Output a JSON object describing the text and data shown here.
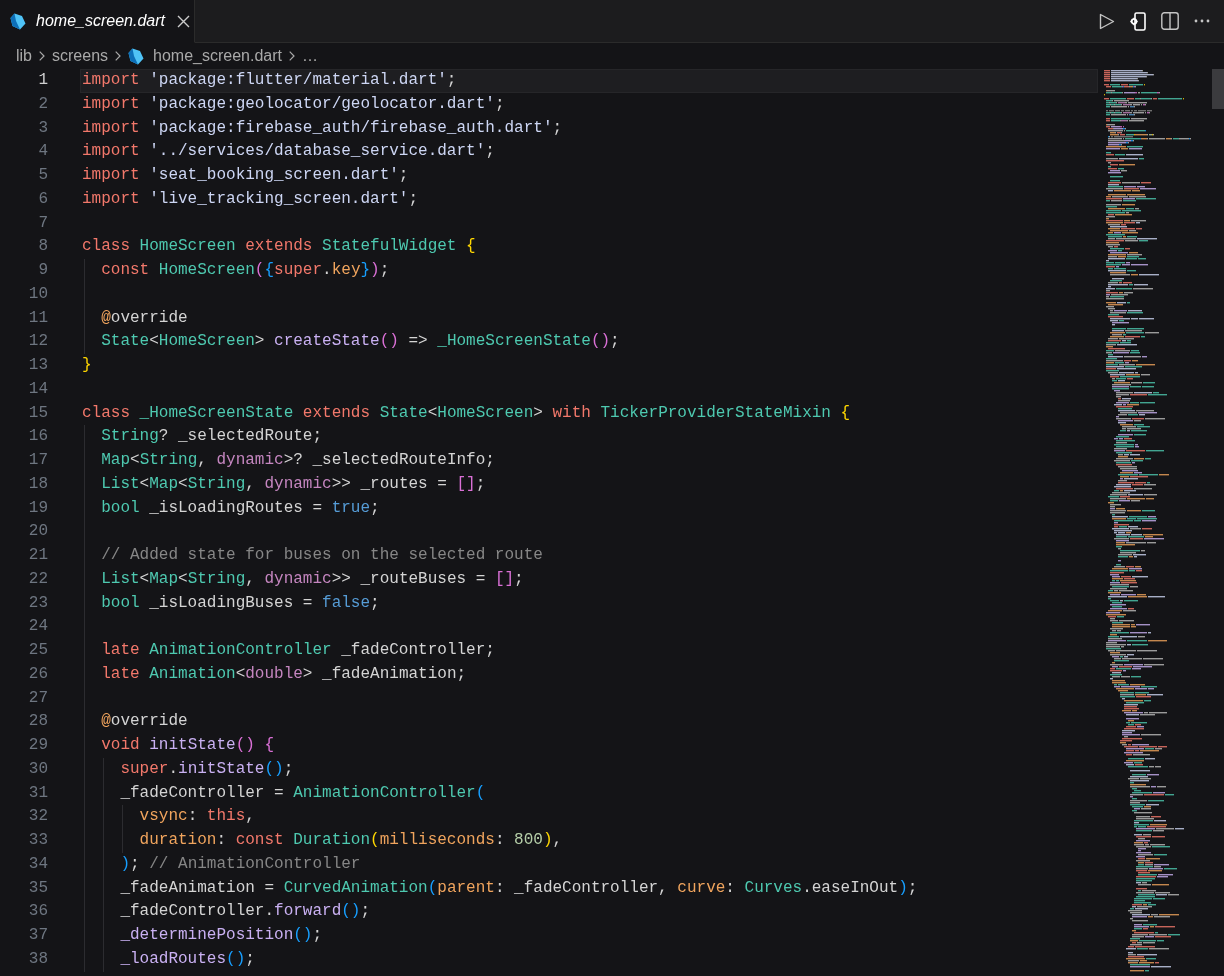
{
  "tabs": [
    {
      "label": "home_screen.dart",
      "selected": true,
      "preview": true
    }
  ],
  "breadcrumbs": [
    {
      "text": "lib",
      "kind": "folder"
    },
    {
      "text": "screens",
      "kind": "folder"
    },
    {
      "text": "home_screen.dart",
      "kind": "file"
    },
    {
      "text": "…",
      "kind": "more"
    }
  ],
  "editor": {
    "lines": [
      {
        "number": "1",
        "current": true,
        "tokens": [
          {
            "text": "import",
            "kind": "keyword"
          },
          {
            "text": " 'package:flutter/material.dart'",
            "kind": "string"
          },
          {
            "text": ";",
            "kind": "plain"
          }
        ]
      },
      {
        "number": "2",
        "current": false,
        "tokens": [
          {
            "text": "import",
            "kind": "keyword"
          },
          {
            "text": " 'package:geolocator/geolocator.dart'",
            "kind": "string"
          },
          {
            "text": ";",
            "kind": "plain"
          }
        ]
      },
      {
        "number": "3",
        "current": false,
        "tokens": [
          {
            "text": "import",
            "kind": "keyword"
          },
          {
            "text": " 'package:firebase_auth/firebase_auth.dart'",
            "kind": "string"
          },
          {
            "text": ";",
            "kind": "plain"
          }
        ]
      },
      {
        "number": "4",
        "current": false,
        "tokens": [
          {
            "text": "import",
            "kind": "keyword"
          },
          {
            "text": " '../services/database_service.dart'",
            "kind": "string"
          },
          {
            "text": ";",
            "kind": "plain"
          }
        ]
      },
      {
        "number": "5",
        "current": false,
        "tokens": [
          {
            "text": "import",
            "kind": "keyword"
          },
          {
            "text": " 'seat_booking_screen.dart'",
            "kind": "string"
          },
          {
            "text": ";",
            "kind": "plain"
          }
        ]
      },
      {
        "number": "6",
        "current": false,
        "tokens": [
          {
            "text": "import",
            "kind": "keyword"
          },
          {
            "text": " 'live_tracking_screen.dart'",
            "kind": "string"
          },
          {
            "text": ";",
            "kind": "plain"
          }
        ]
      },
      {
        "number": "7",
        "current": false
      },
      {
        "number": "8",
        "current": false,
        "tokens": [
          {
            "text": "class ",
            "kind": "keyword"
          },
          {
            "text": "HomeScreen",
            "kind": "type"
          },
          {
            "text": " extends ",
            "kind": "keyword"
          },
          {
            "text": "StatefulWidget",
            "kind": "type"
          },
          {
            "text": " {",
            "kind": "brace1"
          }
        ]
      },
      {
        "number": "9",
        "current": false,
        "tokens": [
          {
            "text": "  const ",
            "kind": "keyword"
          },
          {
            "text": "HomeScreen",
            "kind": "type"
          },
          {
            "text": "(",
            "kind": "brace2"
          },
          {
            "text": "{",
            "kind": "brace3"
          },
          {
            "text": "super",
            "kind": "keyword"
          },
          {
            "text": ".",
            "kind": "plain"
          },
          {
            "text": "key",
            "kind": "param"
          },
          {
            "text": "}",
            "kind": "brace3"
          },
          {
            "text": ")",
            "kind": "brace2"
          },
          {
            "text": ";",
            "kind": "plain"
          }
        ]
      },
      {
        "number": "10",
        "current": false
      },
      {
        "number": "11",
        "current": false,
        "tokens": [
          {
            "text": "  @",
            "kind": "annotation"
          },
          {
            "text": "override",
            "kind": "plain"
          }
        ]
      },
      {
        "number": "12",
        "current": false,
        "tokens": [
          {
            "text": "  State",
            "kind": "type"
          },
          {
            "text": "<",
            "kind": "plain"
          },
          {
            "text": "HomeScreen",
            "kind": "type"
          },
          {
            "text": "> ",
            "kind": "plain"
          },
          {
            "text": "createState",
            "kind": "func"
          },
          {
            "text": "()",
            "kind": "brace2"
          },
          {
            "text": " => ",
            "kind": "plain"
          },
          {
            "text": "_HomeScreenState",
            "kind": "type"
          },
          {
            "text": "()",
            "kind": "brace2"
          },
          {
            "text": ";",
            "kind": "plain"
          }
        ]
      },
      {
        "number": "13",
        "current": false,
        "tokens": [
          {
            "text": "}",
            "kind": "brace1"
          }
        ]
      },
      {
        "number": "14",
        "current": false
      },
      {
        "number": "15",
        "current": false,
        "tokens": [
          {
            "text": "class ",
            "kind": "keyword"
          },
          {
            "text": "_HomeScreenState",
            "kind": "type"
          },
          {
            "text": " extends ",
            "kind": "keyword"
          },
          {
            "text": "State",
            "kind": "type"
          },
          {
            "text": "<",
            "kind": "plain"
          },
          {
            "text": "HomeScreen",
            "kind": "type"
          },
          {
            "text": "> ",
            "kind": "plain"
          },
          {
            "text": "with ",
            "kind": "keyword"
          },
          {
            "text": "TickerProviderStateMixin",
            "kind": "type"
          },
          {
            "text": " {",
            "kind": "brace1"
          }
        ]
      },
      {
        "number": "16",
        "current": false,
        "tokens": [
          {
            "text": "  String",
            "kind": "type"
          },
          {
            "text": "? _selectedRoute;",
            "kind": "plain"
          }
        ]
      },
      {
        "number": "17",
        "current": false,
        "tokens": [
          {
            "text": "  Map",
            "kind": "type"
          },
          {
            "text": "<",
            "kind": "plain"
          },
          {
            "text": "String",
            "kind": "type"
          },
          {
            "text": ", ",
            "kind": "plain"
          },
          {
            "text": "dynamic",
            "kind": "builtin"
          },
          {
            "text": ">? _selectedRouteInfo;",
            "kind": "plain"
          }
        ]
      },
      {
        "number": "18",
        "current": false,
        "tokens": [
          {
            "text": "  List",
            "kind": "type"
          },
          {
            "text": "<",
            "kind": "plain"
          },
          {
            "text": "Map",
            "kind": "type"
          },
          {
            "text": "<",
            "kind": "plain"
          },
          {
            "text": "String",
            "kind": "type"
          },
          {
            "text": ", ",
            "kind": "plain"
          },
          {
            "text": "dynamic",
            "kind": "builtin"
          },
          {
            "text": ">> _routes = ",
            "kind": "plain"
          },
          {
            "text": "[]",
            "kind": "brace2"
          },
          {
            "text": ";",
            "kind": "plain"
          }
        ]
      },
      {
        "number": "19",
        "current": false,
        "tokens": [
          {
            "text": "  bool",
            "kind": "type"
          },
          {
            "text": " _isLoadingRoutes = ",
            "kind": "plain"
          },
          {
            "text": "true",
            "kind": "literal"
          },
          {
            "text": ";",
            "kind": "plain"
          }
        ]
      },
      {
        "number": "20",
        "current": false
      },
      {
        "number": "21",
        "current": false,
        "tokens": [
          {
            "text": "  // Added state for buses on the selected route",
            "kind": "comment"
          }
        ]
      },
      {
        "number": "22",
        "current": false,
        "tokens": [
          {
            "text": "  List",
            "kind": "type"
          },
          {
            "text": "<",
            "kind": "plain"
          },
          {
            "text": "Map",
            "kind": "type"
          },
          {
            "text": "<",
            "kind": "plain"
          },
          {
            "text": "String",
            "kind": "type"
          },
          {
            "text": ", ",
            "kind": "plain"
          },
          {
            "text": "dynamic",
            "kind": "builtin"
          },
          {
            "text": ">> _routeBuses = ",
            "kind": "plain"
          },
          {
            "text": "[]",
            "kind": "brace2"
          },
          {
            "text": ";",
            "kind": "plain"
          }
        ]
      },
      {
        "number": "23",
        "current": false,
        "tokens": [
          {
            "text": "  bool",
            "kind": "type"
          },
          {
            "text": " _isLoadingBuses = ",
            "kind": "plain"
          },
          {
            "text": "false",
            "kind": "literal"
          },
          {
            "text": ";",
            "kind": "plain"
          }
        ]
      },
      {
        "number": "24",
        "current": false
      },
      {
        "number": "25",
        "current": false,
        "tokens": [
          {
            "text": "  late ",
            "kind": "keyword"
          },
          {
            "text": "AnimationController",
            "kind": "type"
          },
          {
            "text": " _fadeController;",
            "kind": "plain"
          }
        ]
      },
      {
        "number": "26",
        "current": false,
        "tokens": [
          {
            "text": "  late ",
            "kind": "keyword"
          },
          {
            "text": "Animation",
            "kind": "type"
          },
          {
            "text": "<",
            "kind": "plain"
          },
          {
            "text": "double",
            "kind": "builtin"
          },
          {
            "text": "> _fadeAnimation;",
            "kind": "plain"
          }
        ]
      },
      {
        "number": "27",
        "current": false
      },
      {
        "number": "28",
        "current": false,
        "tokens": [
          {
            "text": "  @",
            "kind": "annotation"
          },
          {
            "text": "override",
            "kind": "plain"
          }
        ]
      },
      {
        "number": "29",
        "current": false,
        "tokens": [
          {
            "text": "  void ",
            "kind": "keyword"
          },
          {
            "text": "initState",
            "kind": "func"
          },
          {
            "text": "()",
            "kind": "brace2"
          },
          {
            "text": " {",
            "kind": "brace2"
          }
        ]
      },
      {
        "number": "30",
        "current": false,
        "tokens": [
          {
            "text": "    super",
            "kind": "keyword"
          },
          {
            "text": ".",
            "kind": "plain"
          },
          {
            "text": "initState",
            "kind": "func"
          },
          {
            "text": "()",
            "kind": "brace3"
          },
          {
            "text": ";",
            "kind": "plain"
          }
        ]
      },
      {
        "number": "31",
        "current": false,
        "tokens": [
          {
            "text": "    _fadeController = ",
            "kind": "plain"
          },
          {
            "text": "AnimationController",
            "kind": "type"
          },
          {
            "text": "(",
            "kind": "brace3"
          }
        ]
      },
      {
        "number": "32",
        "current": false,
        "tokens": [
          {
            "text": "      vsync",
            "kind": "param"
          },
          {
            "text": ": ",
            "kind": "plain"
          },
          {
            "text": "this",
            "kind": "keyword"
          },
          {
            "text": ",",
            "kind": "plain"
          }
        ]
      },
      {
        "number": "33",
        "current": false,
        "tokens": [
          {
            "text": "      duration",
            "kind": "param"
          },
          {
            "text": ": ",
            "kind": "plain"
          },
          {
            "text": "const ",
            "kind": "keyword"
          },
          {
            "text": "Duration",
            "kind": "type"
          },
          {
            "text": "(",
            "kind": "brace1"
          },
          {
            "text": "milliseconds",
            "kind": "param"
          },
          {
            "text": ": ",
            "kind": "plain"
          },
          {
            "text": "800",
            "kind": "number"
          },
          {
            "text": ")",
            "kind": "brace1"
          },
          {
            "text": ",",
            "kind": "plain"
          }
        ]
      },
      {
        "number": "34",
        "current": false,
        "tokens": [
          {
            "text": "    )",
            "kind": "brace3"
          },
          {
            "text": "; ",
            "kind": "plain"
          },
          {
            "text": "// AnimationController",
            "kind": "comment"
          }
        ]
      },
      {
        "number": "35",
        "current": false,
        "tokens": [
          {
            "text": "    _fadeAnimation = ",
            "kind": "plain"
          },
          {
            "text": "CurvedAnimation",
            "kind": "type"
          },
          {
            "text": "(",
            "kind": "brace3"
          },
          {
            "text": "parent",
            "kind": "param"
          },
          {
            "text": ": _fadeController, ",
            "kind": "plain"
          },
          {
            "text": "curve",
            "kind": "param"
          },
          {
            "text": ": ",
            "kind": "plain"
          },
          {
            "text": "Curves",
            "kind": "type"
          },
          {
            "text": ".easeInOut",
            "kind": "plain"
          },
          {
            "text": ")",
            "kind": "brace3"
          },
          {
            "text": ";",
            "kind": "plain"
          }
        ]
      },
      {
        "number": "36",
        "current": false,
        "tokens": [
          {
            "text": "    _fadeController.",
            "kind": "plain"
          },
          {
            "text": "forward",
            "kind": "func"
          },
          {
            "text": "()",
            "kind": "brace3"
          },
          {
            "text": ";",
            "kind": "plain"
          }
        ]
      },
      {
        "number": "37",
        "current": false,
        "tokens": [
          {
            "text": "    _determinePosition",
            "kind": "func"
          },
          {
            "text": "()",
            "kind": "brace3"
          },
          {
            "text": ";",
            "kind": "plain"
          }
        ]
      },
      {
        "number": "38",
        "current": false,
        "tokens": [
          {
            "text": "    _loadRoutes",
            "kind": "func"
          },
          {
            "text": "()",
            "kind": "brace3"
          },
          {
            "text": ";",
            "kind": "plain"
          }
        ]
      }
    ]
  }
}
